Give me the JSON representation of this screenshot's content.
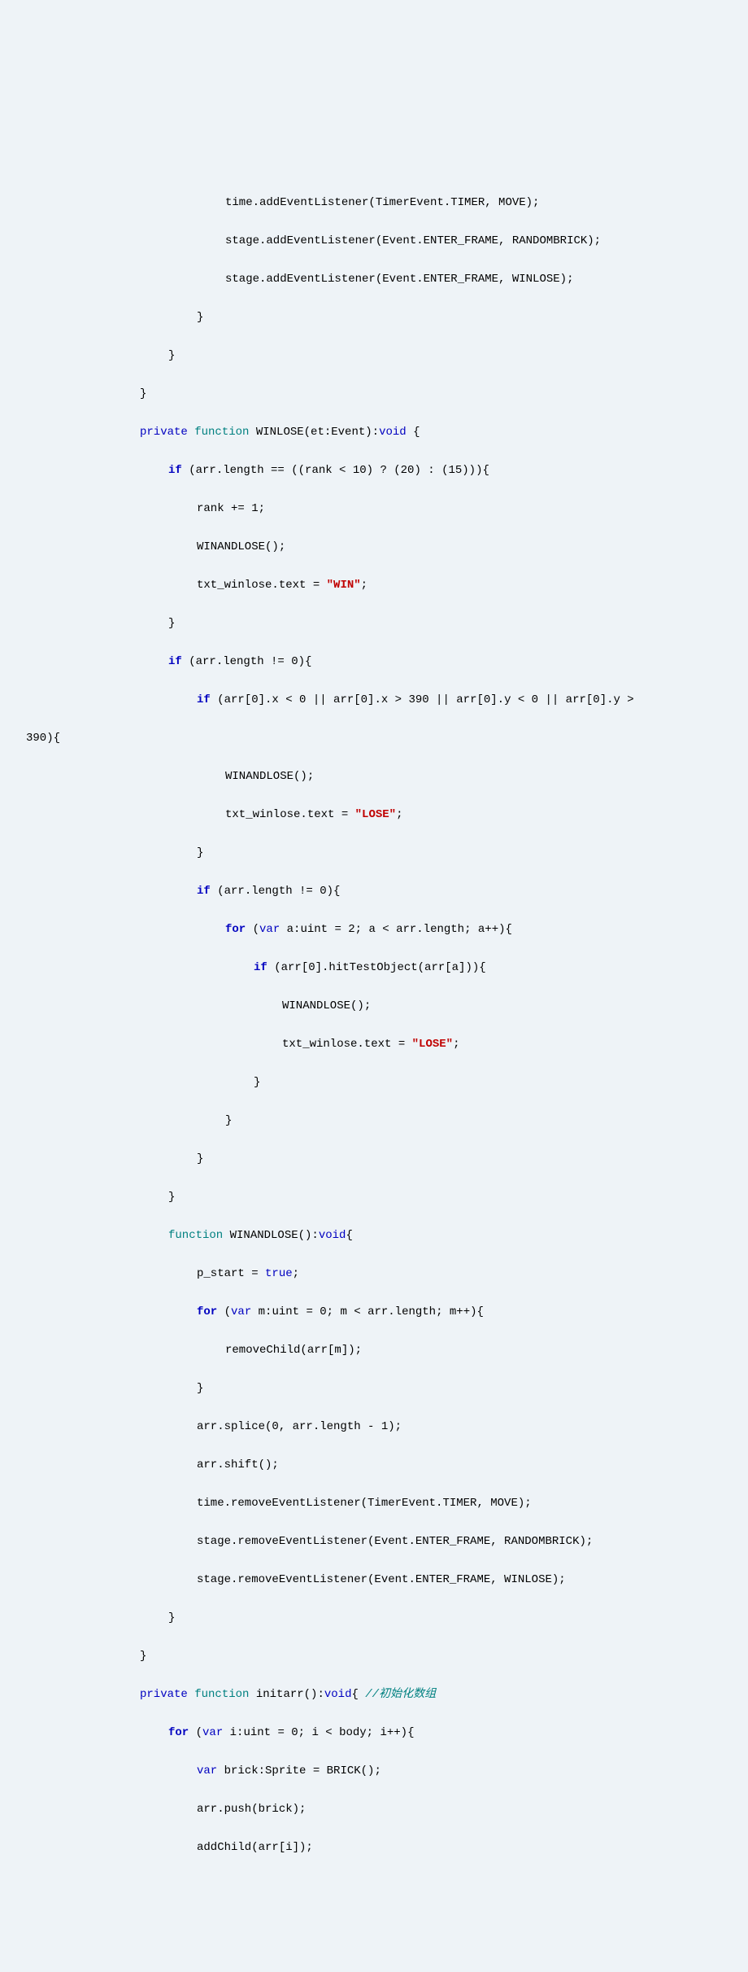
{
  "lines": {
    "l1": "time.addEventListener(TimerEvent.TIMER, MOVE);",
    "l2": "stage.addEventListener(Event.ENTER_FRAME, RANDOMBRICK);",
    "l3": "stage.addEventListener(Event.ENTER_FRAME, WINLOSE);",
    "l4": "}",
    "l5": "}",
    "l6": "}",
    "l7a": "private",
    "l7b": "function",
    "l7c": " WINLOSE(et:Event):",
    "l7d": "void",
    "l7e": " {",
    "l8a": "if",
    "l8b": " (arr.length == ((rank < 10) ? (20) : (15))){",
    "l9": "rank += 1;",
    "l10": "WINANDLOSE();",
    "l11a": "txt_winlose.text = ",
    "l11b": "\"WIN\"",
    "l11c": ";",
    "l12": "}",
    "l13a": "if",
    "l13b": " (arr.length != 0){",
    "l14a": "if",
    "l14b": " (arr[0].x < 0 || arr[0].x > 390 || arr[0].y < 0 || arr[0].y > ",
    "l14c": "390){",
    "l15": "WINANDLOSE();",
    "l16a": "txt_winlose.text = ",
    "l16b": "\"LOSE\"",
    "l16c": ";",
    "l17": "}",
    "l18a": "if",
    "l18b": " (arr.length != 0){",
    "l19a": "for",
    "l19b": " (",
    "l19c": "var",
    "l19d": " a:uint = 2; a < arr.length; a++){",
    "l20a": "if",
    "l20b": " (arr[0].hitTestObject(arr[a])){",
    "l21": "WINANDLOSE();",
    "l22a": "txt_winlose.text = ",
    "l22b": "\"LOSE\"",
    "l22c": ";",
    "l23": "}",
    "l24": "}",
    "l25": "}",
    "l26": "}",
    "l27a": "function",
    "l27b": " WINANDLOSE():",
    "l27c": "void",
    "l27d": "{",
    "l28a": "p_start = ",
    "l28b": "true",
    "l28c": ";",
    "l29a": "for",
    "l29b": " (",
    "l29c": "var",
    "l29d": " m:uint = 0; m < arr.length; m++){",
    "l30": "removeChild(arr[m]);",
    "l31": "}",
    "l32": "arr.splice(0, arr.length - 1);",
    "l33": "arr.shift();",
    "l34": "time.removeEventListener(TimerEvent.TIMER, MOVE);",
    "l35": "stage.removeEventListener(Event.ENTER_FRAME, RANDOMBRICK);",
    "l36": "stage.removeEventListener(Event.ENTER_FRAME, WINLOSE);",
    "l37": "}",
    "l38": "}",
    "l39a": "private",
    "l39b": "function",
    "l39c": " initarr():",
    "l39d": "void",
    "l39e": "{ ",
    "l39f": "//初始化数组",
    "l40a": "for",
    "l40b": " (",
    "l40c": "var",
    "l40d": " i:uint = 0; i < body; i++){",
    "l41a": "var",
    "l41b": " brick:Sprite = BRICK();",
    "l42": "arr.push(brick);",
    "l43": "addChild(arr[i]);"
  }
}
